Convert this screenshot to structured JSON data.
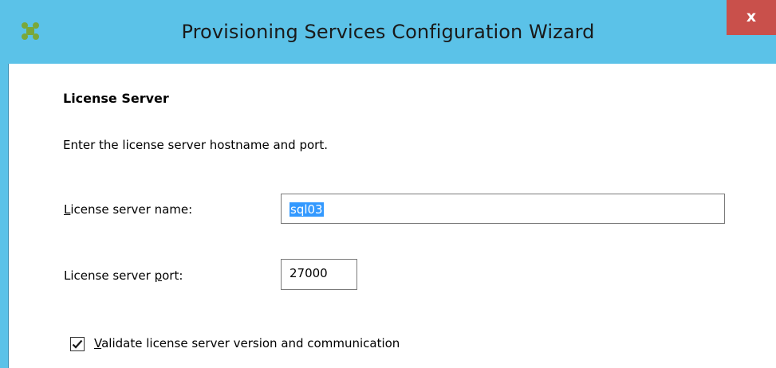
{
  "window": {
    "title": "Provisioning Services Configuration Wizard",
    "close_label": "x",
    "accent_color": "#5bc2e8",
    "close_color": "#c9504b"
  },
  "page": {
    "section_title": "License Server",
    "instructions": "Enter the license server hostname and port."
  },
  "form": {
    "server_name": {
      "label_prefix": "",
      "label_mnemonic": "L",
      "label_rest": "icense server name:",
      "value": "sql03",
      "selected": true
    },
    "server_port": {
      "label_prefix": "License server ",
      "label_mnemonic": "p",
      "label_rest": "ort:",
      "value": "27000"
    },
    "validate": {
      "label_prefix": "",
      "label_mnemonic": "V",
      "label_rest": "alidate license server version and communication",
      "checked": true
    }
  },
  "icons": {
    "app_icon": "citrix-app-icon",
    "close_icon": "close-icon",
    "check_icon": "checkmark-icon"
  }
}
